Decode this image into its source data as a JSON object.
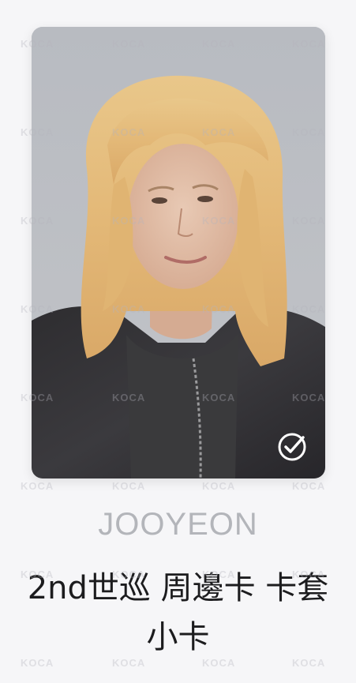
{
  "card": {
    "image_alt": "Photo card of member with long blonde hair wearing a black leather jacket",
    "selected_icon": "check-circle-icon"
  },
  "caption": {
    "member_name": "JOOYEON",
    "item_title": "2nd世巡 周邊卡 卡套小卡"
  },
  "watermark": {
    "text": "KOCA"
  },
  "colors": {
    "background": "#f6f6f8",
    "name_gray": "#b3b5ba",
    "title_black": "#1c1c1e",
    "check_white": "#ffffff"
  }
}
